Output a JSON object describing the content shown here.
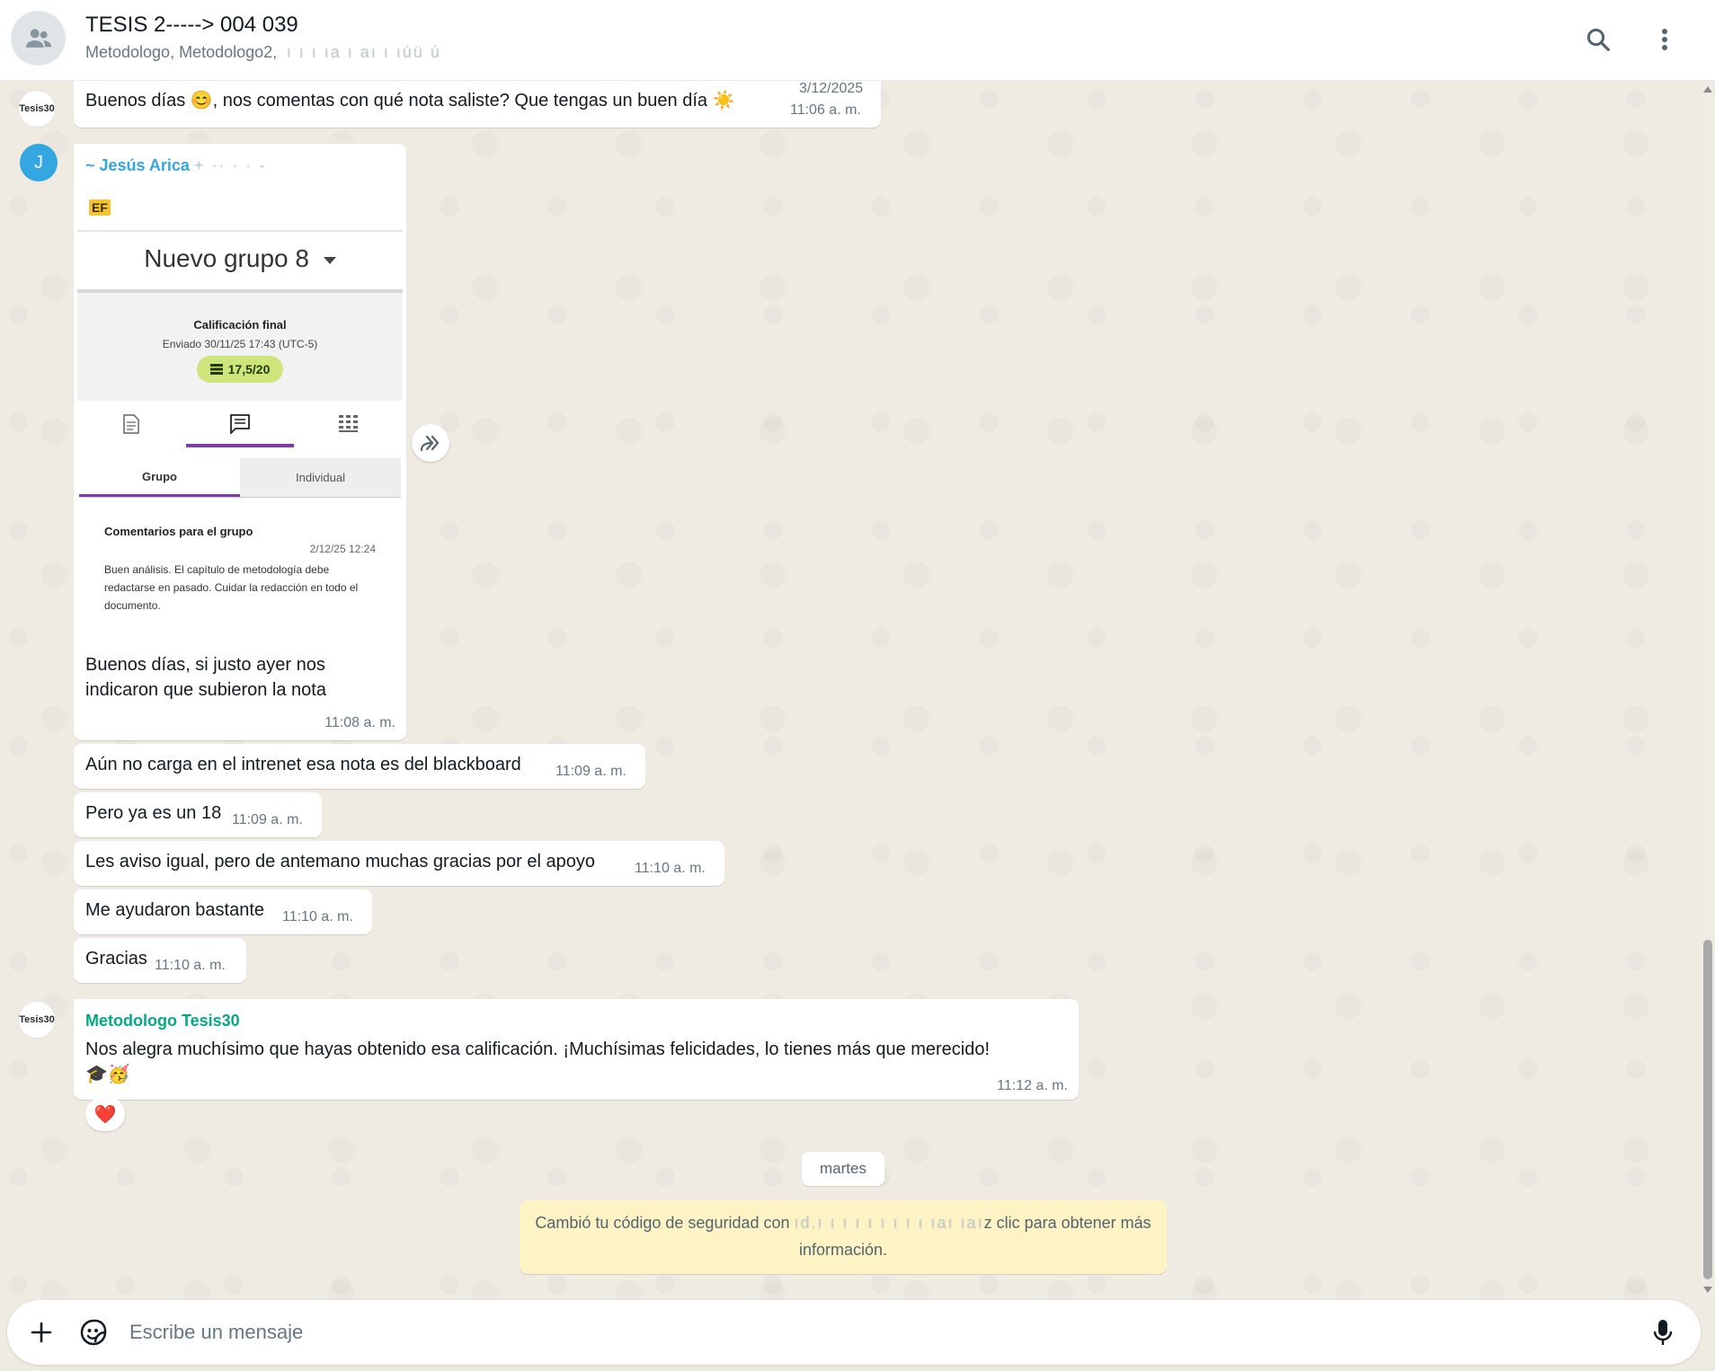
{
  "header": {
    "title": "TESIS 2-----> 004 039",
    "members": "Metodologo, Metodologo2,",
    "members_redacted": " ı ı ı ıa ı aı ı ıúü ú"
  },
  "messages": [
    {
      "text": "Buenos días 😊, nos comentas con qué nota saliste? Que tengas un buen día ☀️",
      "date": "3/12/2025",
      "time": "11:06 a. m."
    },
    {
      "sender": "~ Jesús Arica",
      "sender_redacted": "+ ·· ·  ·  -",
      "image_badge": "EF",
      "image": {
        "group_name": "Nuevo grupo 8",
        "grade_title": "Calificación final",
        "sent": "Enviado 30/11/25 17:43 (UTC-5)",
        "score": "17,5/20",
        "tab_group": "Grupo",
        "tab_individual": "Individual",
        "comments_title": "Comentarios para el grupo",
        "comments_date": "2/12/25 12:24",
        "comments_body": "Buen análisis. El capítulo de metodología debe redactarse en pasado. Cuidar la redacción en todo el documento."
      },
      "caption": "Buenos días, si justo ayer nos indicaron que subieron la nota",
      "time": "11:08 a. m."
    },
    {
      "text": "Aún no carga en el intrenet esa nota es del blackboard",
      "time": "11:09 a. m."
    },
    {
      "text": "Pero ya es un 18",
      "time": "11:09 a. m."
    },
    {
      "text": "Les aviso igual, pero de antemano muchas gracias por el apoyo",
      "time": "11:10 a. m."
    },
    {
      "text": "Me ayudaron bastante",
      "time": "11:10 a. m."
    },
    {
      "text": "Gracias",
      "time": "11:10 a. m."
    },
    {
      "sender": "Metodologo Tesis30",
      "text": "Nos alegra muchísimo que hayas obtenido esa calificación. ¡Muchísimas felicidades, lo tienes más que merecido!",
      "emojis": "🎓🥳",
      "time": "11:12 a. m.",
      "reaction": "❤️"
    }
  ],
  "avatars": {
    "tesis_label": "Tesis30",
    "j_initial": "J"
  },
  "day_separator": "martes",
  "security_notice": {
    "prefix": "Cambió tu código de seguridad con",
    "redacted": "ıd.ı ı ı ı ı ı ı ı ı ıaı ıaı",
    "suffix": "z clic para obtener más",
    "line2": "información."
  },
  "composer": {
    "placeholder": "Escribe un mensaje"
  },
  "colors": {
    "sender_jesus": "#35a7e0",
    "sender_metodologo": "#06a884",
    "score_pill": "#cde57a",
    "tab_accent": "#7a3ea6",
    "notice_bg": "#fdf3c5"
  }
}
